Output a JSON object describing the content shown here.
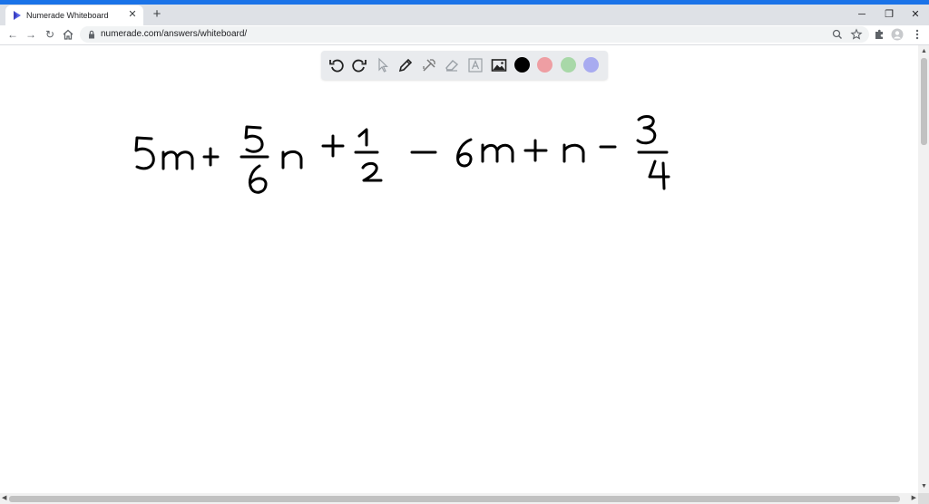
{
  "browser": {
    "tab": {
      "title": "Numerade Whiteboard",
      "close_glyph": "✕",
      "favicon": "numerade-logo-icon"
    },
    "new_tab_glyph": "+",
    "window_controls": {
      "minimize": "─",
      "restore": "❐",
      "close": "✕"
    },
    "nav": {
      "back": "←",
      "forward": "→",
      "reload": "↻",
      "home": "home-icon"
    },
    "address": {
      "url": "numerade.com/answers/whiteboard/",
      "lock": "lock-icon"
    },
    "omnibox_icons": [
      "zoom-icon",
      "star-icon"
    ],
    "toolbar_icons": [
      "extensions-icon",
      "profile-icon",
      "menu-icon"
    ]
  },
  "whiteboard": {
    "tools": [
      "undo-icon",
      "redo-icon",
      "select-icon",
      "pen-icon",
      "tools-icon",
      "eraser-icon",
      "text-icon",
      "image-icon"
    ],
    "colors": [
      "#000000",
      "#ee9ea3",
      "#a8d8a8",
      "#a8abf0"
    ],
    "handwritten_expression": "5m + 5/6 n + 1/2 − 6m + n − 3/4"
  }
}
